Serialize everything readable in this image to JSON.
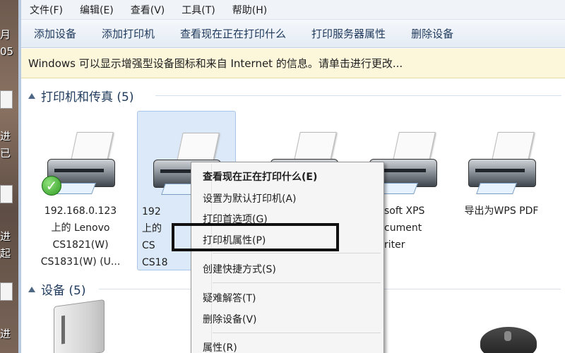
{
  "desktop": {
    "items": [
      "月",
      "05",
      "进",
      "已",
      "进",
      "起",
      "进"
    ]
  },
  "menubar": {
    "items": [
      "文件(F)",
      "编辑(E)",
      "查看(V)",
      "工具(T)",
      "帮助(H)"
    ]
  },
  "commandbar": {
    "items": [
      "添加设备",
      "添加打印机",
      "查看现在正在打印什么",
      "打印服务器属性",
      "删除设备"
    ]
  },
  "infobar": {
    "text": "Windows 可以显示增强型设备图标和来自 Internet 的信息。请单击进行更改..."
  },
  "groups": {
    "printers": {
      "title": "打印机和传真 (5)"
    },
    "devices": {
      "title": "设备 (5)"
    }
  },
  "printers": [
    {
      "label": "192.168.0.123\n上的 Lenovo\nCS1821(W)\nCS1831(W) (U...",
      "default": true
    },
    {
      "label": "192\n上的\nCS\nCS18",
      "default": false
    },
    {
      "label": "",
      "default": false
    },
    {
      "label": "soft XPS\ncument\nriter",
      "default": false
    },
    {
      "label": "导出为WPS PDF",
      "default": false
    }
  ],
  "context_menu": {
    "items": [
      {
        "label": "查看现在正在打印什么(E)",
        "bold": true
      },
      {
        "label": "设置为默认打印机(A)"
      },
      {
        "label": "打印首选项(G)"
      },
      {
        "label": "打印机属性(P)"
      },
      {
        "label": "创建快捷方式(S)"
      },
      {
        "label": "疑难解答(T)"
      },
      {
        "label": "删除设备(V)"
      },
      {
        "label": "属性(R)"
      }
    ]
  },
  "colors": {
    "accent": "#1e395b",
    "infobar_bg": "#fcf7db",
    "selection": "#dce9f8"
  }
}
